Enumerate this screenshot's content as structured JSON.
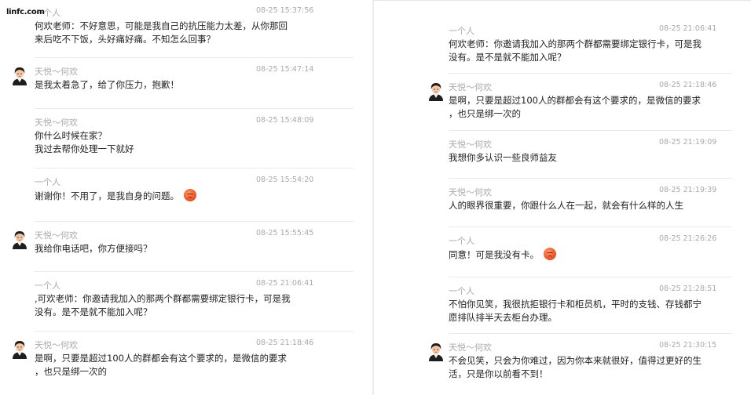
{
  "watermark": "linfc.com",
  "left_messages": [
    {
      "sender": "一个人",
      "time": "08-25 15:37:56",
      "avatar": false,
      "text": "何欢老师：不好意思，可能是我自己的抗压能力太差，从你那回\n来后吃不下饭，头好痛好痛。不知怎么回事？",
      "emoji": false
    },
    {
      "sender": "天悦～何欢",
      "time": "08-25 15:47:14",
      "avatar": true,
      "text": "是我太着急了，给了你压力，抱歉！",
      "emoji": false
    },
    {
      "sender": "天悦～何欢",
      "time": "08-25 15:48:09",
      "avatar": false,
      "text": "你什么时候在家？\n我过去帮你处理一下就好",
      "emoji": false
    },
    {
      "sender": "一个人",
      "time": "08-25 15:54:20",
      "avatar": false,
      "text": "谢谢你！不用了，是我自身的问题。",
      "emoji": true
    },
    {
      "sender": "天悦～何欢",
      "time": "08-25 15:55:45",
      "avatar": true,
      "text": "我给你电话吧，你方便接吗？",
      "emoji": false
    },
    {
      "sender": "一个人",
      "time": "08-25 21:06:41",
      "avatar": false,
      "text": ",可欢老师：你邀请我加入的那两个群都需要绑定银行卡，可是我\n没有。是不是就不能加入呢？",
      "emoji": false
    },
    {
      "sender": "天悦～何欢",
      "time": "08-25 21:18:46",
      "avatar": true,
      "text": "是啊，只要是超过100人的群都会有这个要求的，是微信的要求\n，也只是绑一次的",
      "emoji": false
    }
  ],
  "right_messages": [
    {
      "sender": "一个人",
      "time": "08-25 21:06:41",
      "avatar": false,
      "text": "何欢老师：你邀请我加入的那两个群都需要绑定银行卡，可是我\n没有。是不是就不能加入呢？",
      "emoji": false
    },
    {
      "sender": "天悦～何欢",
      "time": "08-25 21:18:46",
      "avatar": true,
      "text": "是啊，只要是超过100人的群都会有这个要求的，是微信的要求\n，也只是绑一次的",
      "emoji": false
    },
    {
      "sender": "天悦～何欢",
      "time": "08-25 21:19:09",
      "avatar": false,
      "text": "我想你多认识一些良师益友",
      "emoji": false
    },
    {
      "sender": "天悦～何欢",
      "time": "08-25 21:19:39",
      "avatar": false,
      "text": "人的眼界很重要，你跟什么人在一起，就会有什么样的人生",
      "emoji": false
    },
    {
      "sender": "一个人",
      "time": "08-25 21:26:26",
      "avatar": false,
      "text": "同意！可是我没有卡。",
      "emoji": true
    },
    {
      "sender": "一个人",
      "time": "08-25 21:28:51",
      "avatar": false,
      "text": "不怕你见笑，我很抗拒银行卡和柜员机，平时的支钱、存钱都宁\n愿排队排半天去柜台办理。",
      "emoji": false
    },
    {
      "sender": "天悦～何欢",
      "time": "08-25 21:30:15",
      "avatar": true,
      "text": "不会见笑，只会为你难过，因为你本来就很好，值得过更好的生\n活，只是你以前看不到！",
      "emoji": false
    }
  ]
}
